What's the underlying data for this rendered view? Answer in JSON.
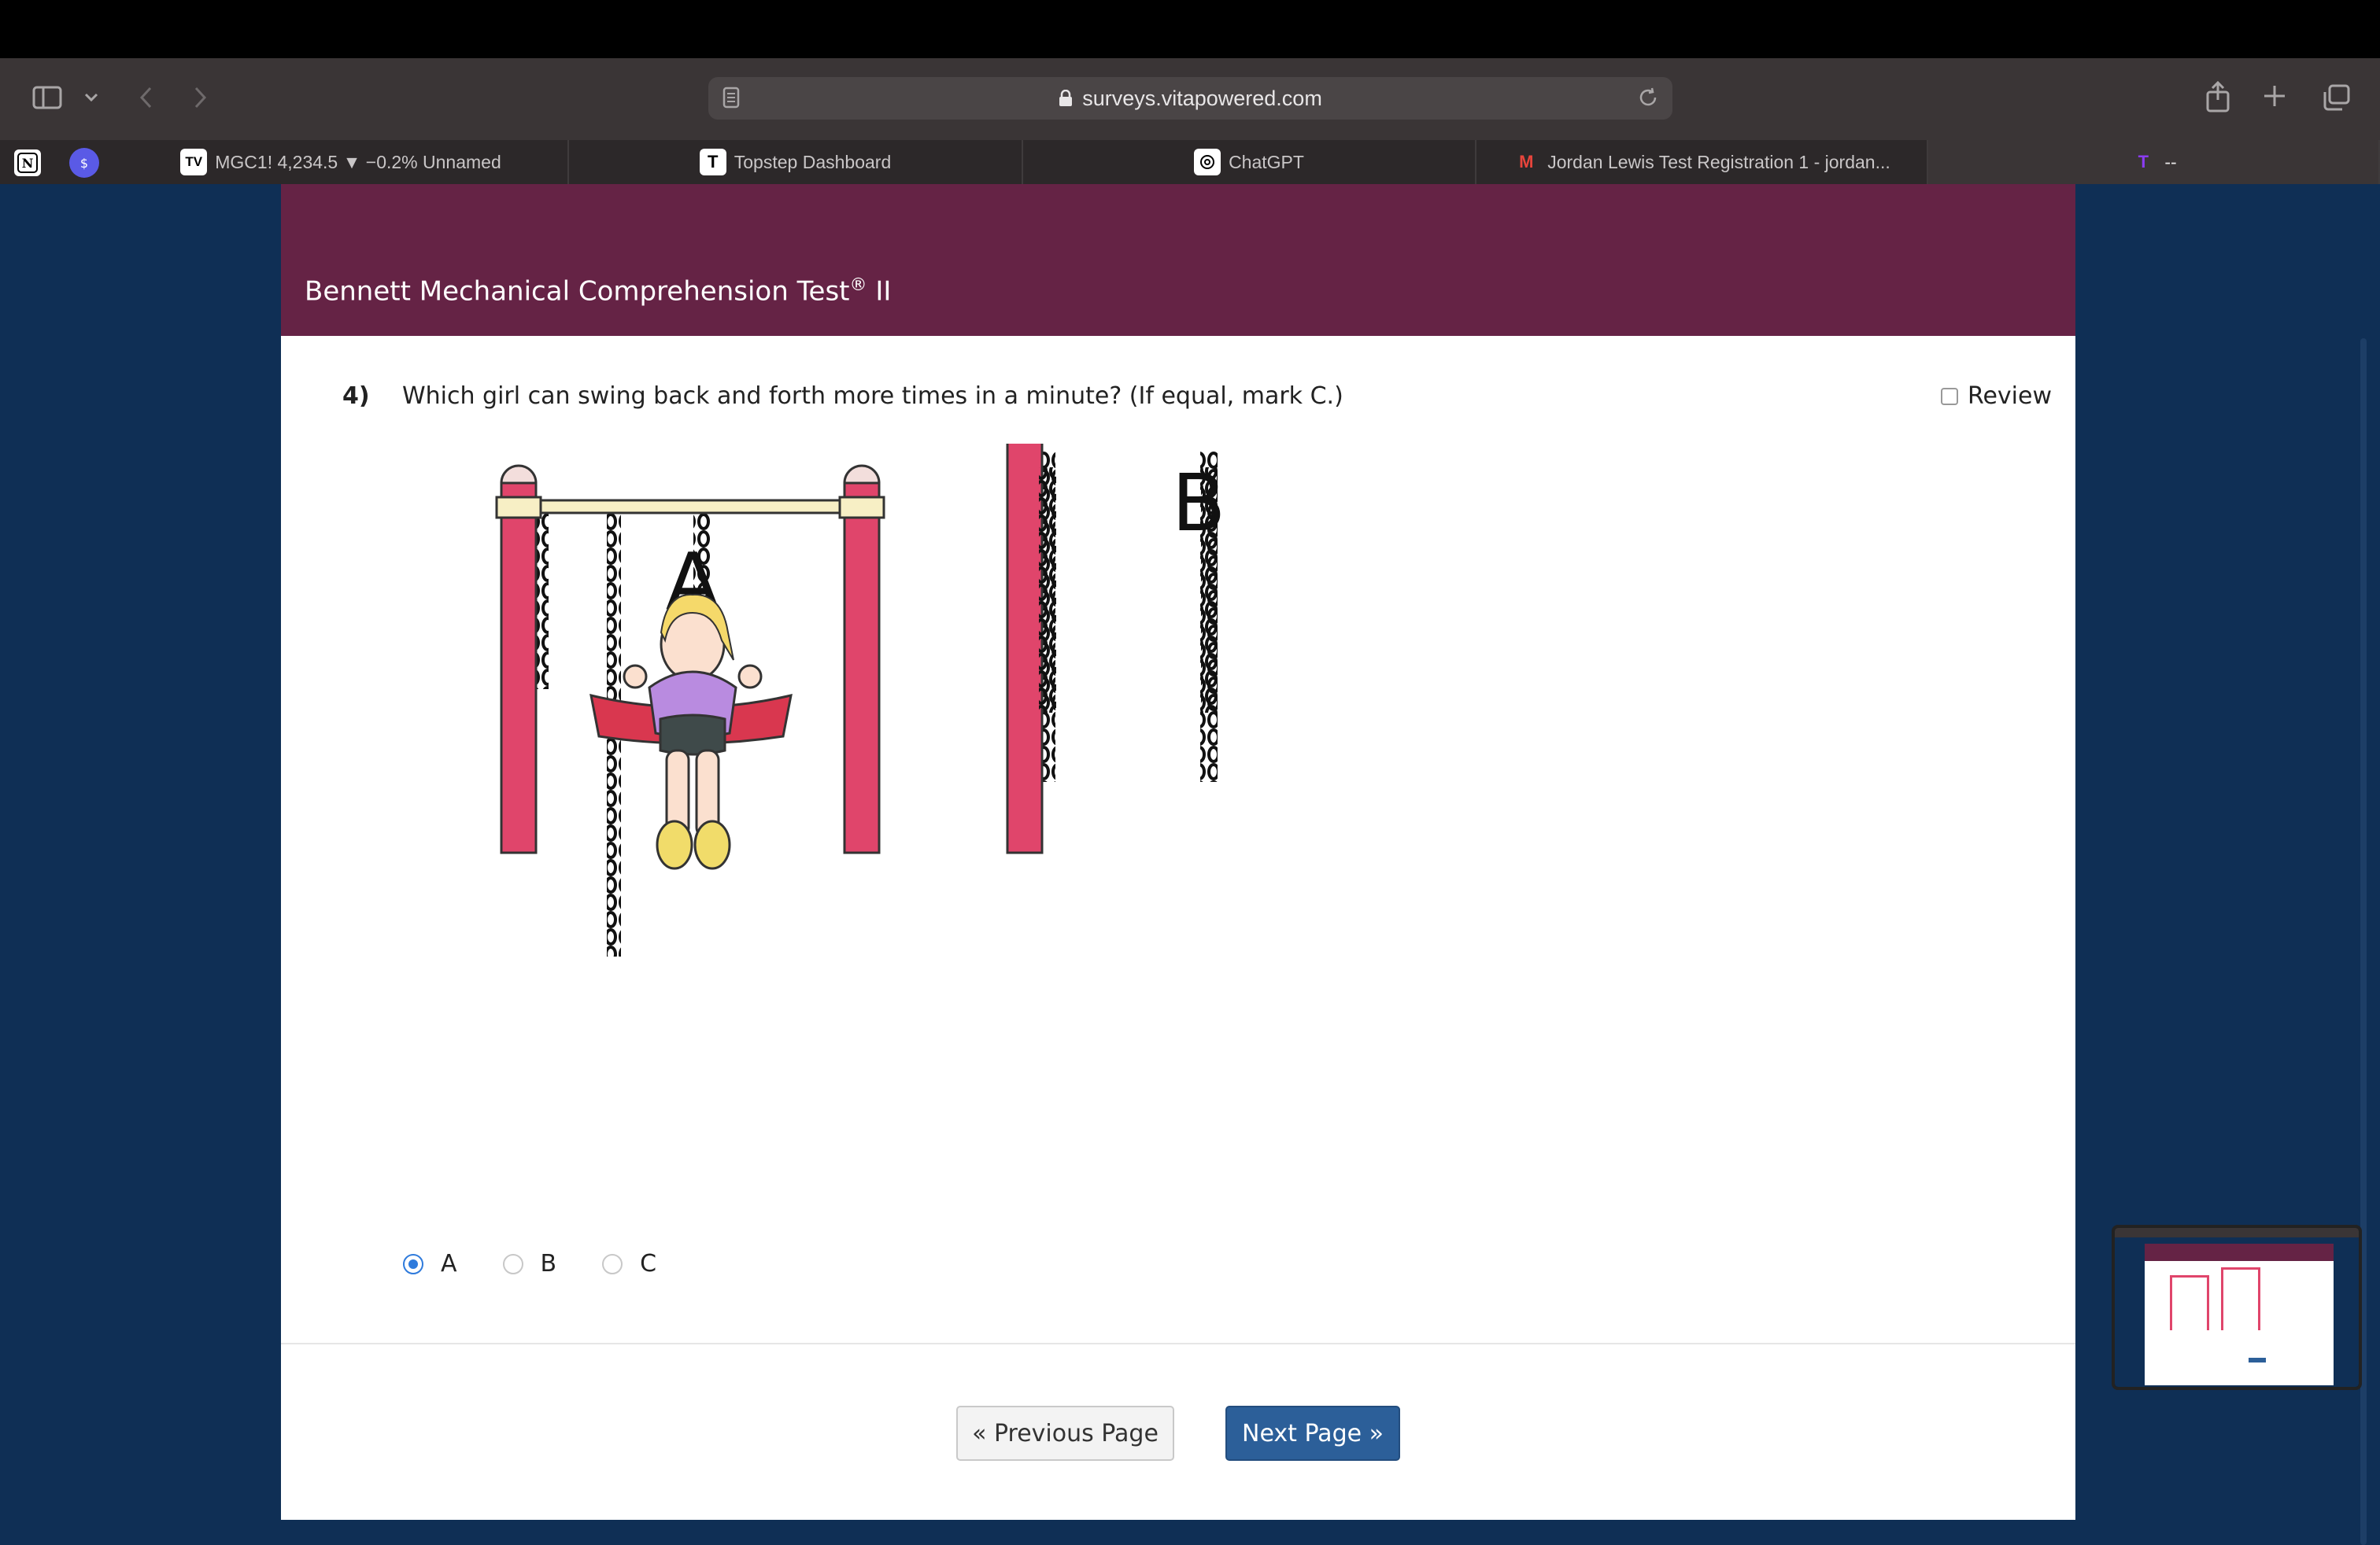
{
  "browser": {
    "url": "surveys.vitapowered.com",
    "pinned_tabs": [
      "notion-icon",
      "dollar-icon"
    ],
    "tabs": [
      {
        "label": "MGC1! 4,234.5 ▼ −0.2% Unnamed",
        "favicon": "TV"
      },
      {
        "label": "Topstep Dashboard",
        "favicon": "T"
      },
      {
        "label": "ChatGPT",
        "favicon": "chatgpt-icon"
      },
      {
        "label": "Jordan Lewis Test Registration 1 - jordan...",
        "favicon": "M"
      },
      {
        "label": "--",
        "favicon": "T"
      }
    ]
  },
  "survey": {
    "title": "Bennett Mechanical Comprehension Test",
    "title_mark": "®",
    "title_suffix": " II",
    "question_number": "4)",
    "question_text": "Which girl can swing back and forth more times in a minute? (If equal, mark C.)",
    "review_label": "Review",
    "figure_labels": {
      "a": "A",
      "b": "B"
    },
    "options": [
      {
        "label": "A",
        "selected": true
      },
      {
        "label": "B",
        "selected": false
      },
      {
        "label": "C",
        "selected": false
      }
    ],
    "prev_button": "« Previous Page",
    "next_button": "Next Page »"
  },
  "colors": {
    "banner": "#652345",
    "page_bg": "#0f2f55",
    "next_button": "#2c5f99",
    "radio_selected": "#2f7bdc",
    "swing_post": "#e0456b"
  }
}
